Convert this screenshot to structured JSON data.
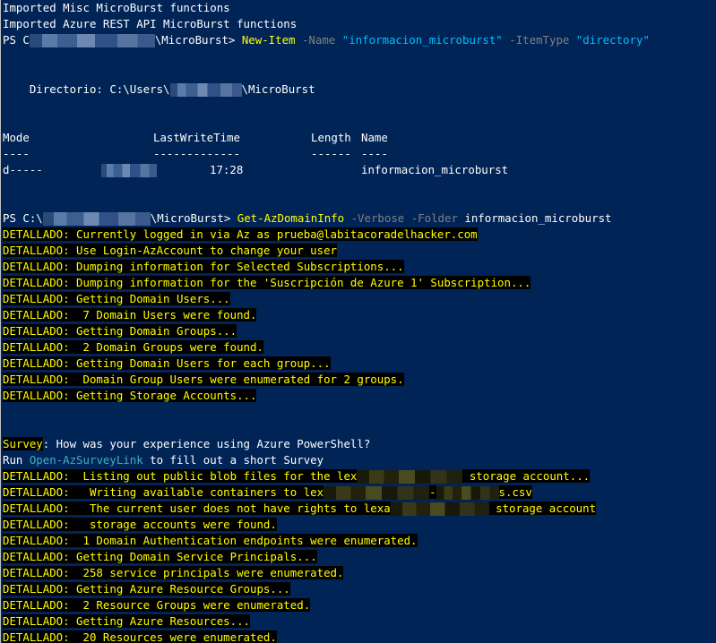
{
  "lines": {
    "l1": "Imported Misc MicroBurst functions",
    "l2": "Imported Azure REST API MicroBurst functions",
    "l3_prefix": "PS C",
    "l3_path_suffix": "\\MicroBurst> ",
    "l3_cmd": "New-Item",
    "l3_p1": " -Name ",
    "l3_s1": "\"informacion_microburst\"",
    "l3_p2": " -ItemType ",
    "l3_s2": "\"directory\"",
    "l4_prefix": "    Directorio: C:\\Users\\",
    "l4_suffix": "\\MicroBurst",
    "h_mode": "Mode",
    "h_lwt": "LastWriteTime",
    "h_len": "Length",
    "h_name": "Name",
    "d_mode": "----",
    "d_lwt": "-------------",
    "d_len": "------",
    "d_name": "----",
    "r_mode": "d-----",
    "r_time": "17:28",
    "r_name": "informacion_microburst",
    "l5_prefix": "PS C:\\",
    "l5_suffix": "\\MicroBurst> ",
    "l5_cmd": "Get-AzDomainInfo",
    "l5_p1": " -Verbose -Folder ",
    "l5_arg": "informacion_microburst",
    "v1": "DETALLADO: Currently logged in via Az as prueba@labitacoradelhacker.com",
    "v2": "DETALLADO: Use Login-AzAccount to change your user",
    "v3": "DETALLADO: Dumping information for Selected Subscriptions...",
    "v4": "DETALLADO: Dumping information for the 'Suscripción de Azure 1' Subscription...",
    "v5": "DETALLADO: Getting Domain Users...",
    "v6": "DETALLADO:  7 Domain Users were found.",
    "v7": "DETALLADO: Getting Domain Groups...",
    "v8": "DETALLADO:  2 Domain Groups were found.",
    "v9": "DETALLADO: Getting Domain Users for each group...",
    "v10": "DETALLADO:  Domain Group Users were enumerated for 2 groups.",
    "v11": "DETALLADO: Getting Storage Accounts...",
    "survey_label": "Survey",
    "survey_text": ": How was your experience using Azure PowerShell?",
    "run_prefix": "Run ",
    "run_link": "Open-AzSurveyLink",
    "run_suffix": " to fill out a short Survey",
    "v12_a": "DETALLADO:  Listing out public blob files for the lex",
    "v12_b": " storage account...",
    "v13_a": "DETALLADO:   Writing available containers to lex",
    "v13_b": "-",
    "v13_c": "s.csv",
    "v14_a": "DETALLADO:   The current user does not have rights to lexa",
    "v14_b": " storage account",
    "v15": "DETALLADO:   storage accounts were found.",
    "v16": "DETALLADO:  1 Domain Authentication endpoints were enumerated.",
    "v17": "DETALLADO: Getting Domain Service Principals...",
    "v18": "DETALLADO:  258 service principals were enumerated.",
    "v19": "DETALLADO: Getting Azure Resource Groups...",
    "v20": "DETALLADO:  2 Resource Groups were enumerated.",
    "v21": "DETALLADO: Getting Azure Resources...",
    "v22": "DETALLADO:  20 Resources were enumerated."
  },
  "colors": {
    "background": "#012456",
    "command": "#ffff00",
    "parameter": "#808080",
    "string": "#00bfff",
    "verbose_fg": "#ffff00",
    "verbose_bg": "#000000"
  }
}
